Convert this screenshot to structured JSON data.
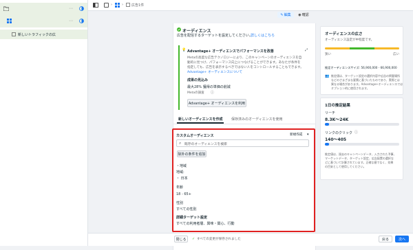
{
  "sidebar": {
    "items": [
      {
        "label": "",
        "icon": "folder-icon"
      },
      {
        "label": "",
        "icon": "grid-icon"
      },
      {
        "label": "新しいトラフィックの広"
      }
    ]
  },
  "topbar": {
    "breadcrumb": "広告1件",
    "edit_label": "編集",
    "review_label": "確認"
  },
  "audience": {
    "title": "オーディエンス",
    "subtitle": "広告を配信するターゲットを設定してください。",
    "link": "詳しくはこちら",
    "advantage_title": "Advantage+ オーディエンスでパフォーマンスを改善",
    "advantage_body1": "Metaの高度な広告テクノロジーにより、このキャンペーンのオーディエンスを自",
    "advantage_body2": "動的に見つけ、パフォーマンス向上につなげることができます。あなたが条件を",
    "advantage_body3": "指定しても、広告を表示するべきではない人をコントロールすることもできます。",
    "advantage_link": "Advantage+ オーディエンスについて",
    "results_label": "成果の見込み",
    "results_value": "最大28% 獲得の単価の削減",
    "results_note": "Metaの調査",
    "use_button": "Advantage+ オーディエンスを利用",
    "tab_new": "新しいオーディエンスを作成",
    "tab_saved": "保存済みのオーディエンスを使用"
  },
  "custom_audience": {
    "title": "カスタムオーディエンス",
    "new_label": "新規作成",
    "search_placeholder": "既存のオーディエンスを検索",
    "exclude_button": "除外の条件を追加",
    "location_label": "・地域",
    "location_sub": "地域:",
    "location_value": "・ 日本",
    "age_label": "年齢",
    "age_value": "18 - 65+",
    "gender_label": "性別",
    "gender_value": "すべての性別",
    "detail_label": "詳細ターゲット設定",
    "detail_value": "すべての利用者層、興味・関心、行動"
  },
  "audience_size": {
    "title": "オーディエンスの広さ",
    "subtitle": "オーディエンス設定が中程度です。",
    "narrow": "狭い",
    "wide": "広い",
    "estimate": "推定オーディエンスサイズ: 56,900,000 - 66,900,000",
    "note1": "推定値は、ターゲット設定の選択内容や広告の掲載場所",
    "note2": "などのさまざまな要素に基づいたものであり、実際とは",
    "note3": "異なる場合があります。Advantage+オーディエンスでは",
    "note4": "オプション的に使用されます。",
    "level": 0.55
  },
  "daily_results": {
    "title": "1日の推定結果",
    "reach_label": "リーチ",
    "reach_value": "8.3K〜24K",
    "clicks_label": "リンクのクリック",
    "clicks_value": "140〜405",
    "note1": "推定値は、過去のキャンペーンデータ、入力された予算、",
    "note2": "マーケットデータ、ターゲット設定、広告配置の選択な",
    "note3": "どに基づいて計算されています。正確な値でなく、効果",
    "note4": "の目安として使用してください。"
  },
  "bottom": {
    "close": "閉じる",
    "saved": "すべての変更が保存されました",
    "back": "戻る",
    "next": "次へ"
  },
  "colors": {
    "accent": "#1877f2",
    "highlight": "#e02020",
    "green": "#42b72a"
  }
}
